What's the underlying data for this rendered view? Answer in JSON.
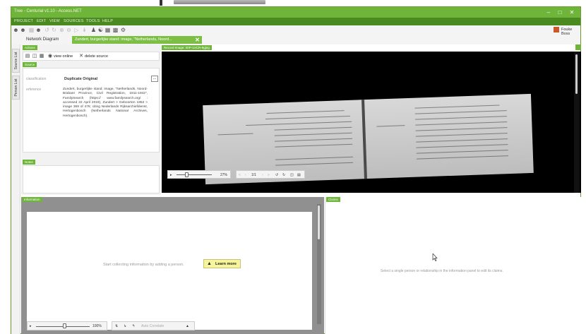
{
  "window": {
    "title": "Tree - Centurial v1.10 - Access.NET",
    "minimize": "–",
    "maximize": "□",
    "close": "✕"
  },
  "menu": [
    "PROJECT",
    "EDIT",
    "VIEW",
    "SOURCES",
    "TOOLS",
    "HELP"
  ],
  "toolbar": {
    "icons": [
      "people-icon",
      "people-icon",
      "tree-icon",
      "tree-icon",
      "undo-icon",
      "redo-icon",
      "forward-icon",
      "back-icon",
      "play-icon",
      "skip-icon",
      "add-person-icon",
      "family-icon",
      "building-icon",
      "calendar-icon",
      "gear-icon"
    ],
    "user_name": "Fouke Boss"
  },
  "tabs": {
    "network": "Network Diagram",
    "active": "Zundert, burgerlijke stand: image, \"Netherlands, Noord..."
  },
  "side_tabs": [
    "Source List",
    "Person List"
  ],
  "actions": {
    "label": "Actions",
    "view_online": "view online",
    "delete_source": "delete source"
  },
  "source": {
    "label": "Source",
    "classification_key": "classification",
    "classification_value": "Duplicate Original",
    "reference_key": "reference",
    "reference_value": "Zundert, burgerlijke stand; image, \"Netherlands, Noord-Brabant Province, Civil Registration, 1811-1942\", FamilySearch (https:// www.familysearch.org/ : accessed 22 April 2019), Zundert > Geboorten 1853 > image 369 of 476; citing Nederlands Rijksarchiefdienst, Hertogenbosch (Netherlands National Archives, Hertogenbosch).",
    "more_button": "..."
  },
  "notes": {
    "label": "Notes"
  },
  "viewer": {
    "label": "Record Image: 00P-1XCR-9gjeg",
    "zoom": "27%",
    "page": "1/1"
  },
  "information": {
    "label": "Information",
    "message": "Start collecting information by adding a person.",
    "learn_more": "Learn more",
    "zoom": "100%",
    "auto_correlate": "Auto Correlate"
  },
  "claims": {
    "label": "Claims",
    "message": "Select a single person or relationship in the information panel to edit its claims."
  }
}
